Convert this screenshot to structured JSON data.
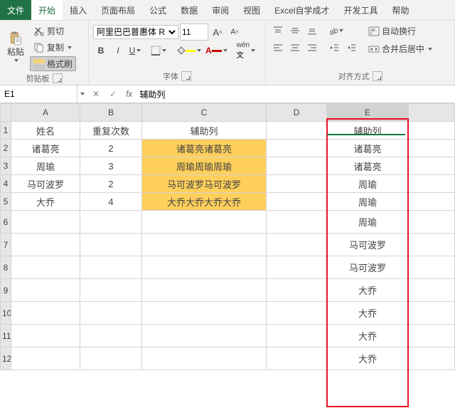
{
  "tabs": {
    "file": "文件",
    "home": "开始",
    "insert": "插入",
    "layout": "页面布局",
    "formulas": "公式",
    "data": "数据",
    "review": "审阅",
    "view": "视图",
    "learn": "Excel自学成才",
    "dev": "开发工具",
    "help": "帮助"
  },
  "ribbon": {
    "paste": "粘贴",
    "cut": "剪切",
    "copy": "复制",
    "format_painter": "格式刷",
    "clipboard_label": "剪贴板",
    "font_name": "阿里巴巴普惠体 R",
    "font_size": "11",
    "font_label": "字体",
    "align_label": "对齐方式",
    "wrap": "自动换行",
    "merge": "合并后居中"
  },
  "namebox": "E1",
  "formula": "辅助列",
  "fx": "fx",
  "headers": [
    "A",
    "B",
    "C",
    "D",
    "E",
    ""
  ],
  "rows": [
    {
      "n": "1",
      "A": "姓名",
      "B": "重复次数",
      "C": "辅助列",
      "D": "",
      "E": "辅助列"
    },
    {
      "n": "2",
      "A": "诸葛亮",
      "B": "2",
      "C": "诸葛亮诸葛亮",
      "D": "",
      "E": "诸葛亮"
    },
    {
      "n": "3",
      "A": "周瑜",
      "B": "3",
      "C": "周瑜周瑜周瑜",
      "D": "",
      "E": "诸葛亮"
    },
    {
      "n": "4",
      "A": "马可波罗",
      "B": "2",
      "C": "马可波罗马可波罗",
      "D": "",
      "E": "周瑜"
    },
    {
      "n": "5",
      "A": "大乔",
      "B": "4",
      "C": "大乔大乔大乔大乔",
      "D": "",
      "E": "周瑜"
    },
    {
      "n": "6",
      "A": "",
      "B": "",
      "C": "",
      "D": "",
      "E": "周瑜"
    },
    {
      "n": "7",
      "A": "",
      "B": "",
      "C": "",
      "D": "",
      "E": "马可波罗"
    },
    {
      "n": "8",
      "A": "",
      "B": "",
      "C": "",
      "D": "",
      "E": "马可波罗"
    },
    {
      "n": "9",
      "A": "",
      "B": "",
      "C": "",
      "D": "",
      "E": "大乔"
    },
    {
      "n": "10",
      "A": "",
      "B": "",
      "C": "",
      "D": "",
      "E": "大乔"
    },
    {
      "n": "11",
      "A": "",
      "B": "",
      "C": "",
      "D": "",
      "E": "大乔"
    },
    {
      "n": "12",
      "A": "",
      "B": "",
      "C": "",
      "D": "",
      "E": "大乔"
    }
  ]
}
